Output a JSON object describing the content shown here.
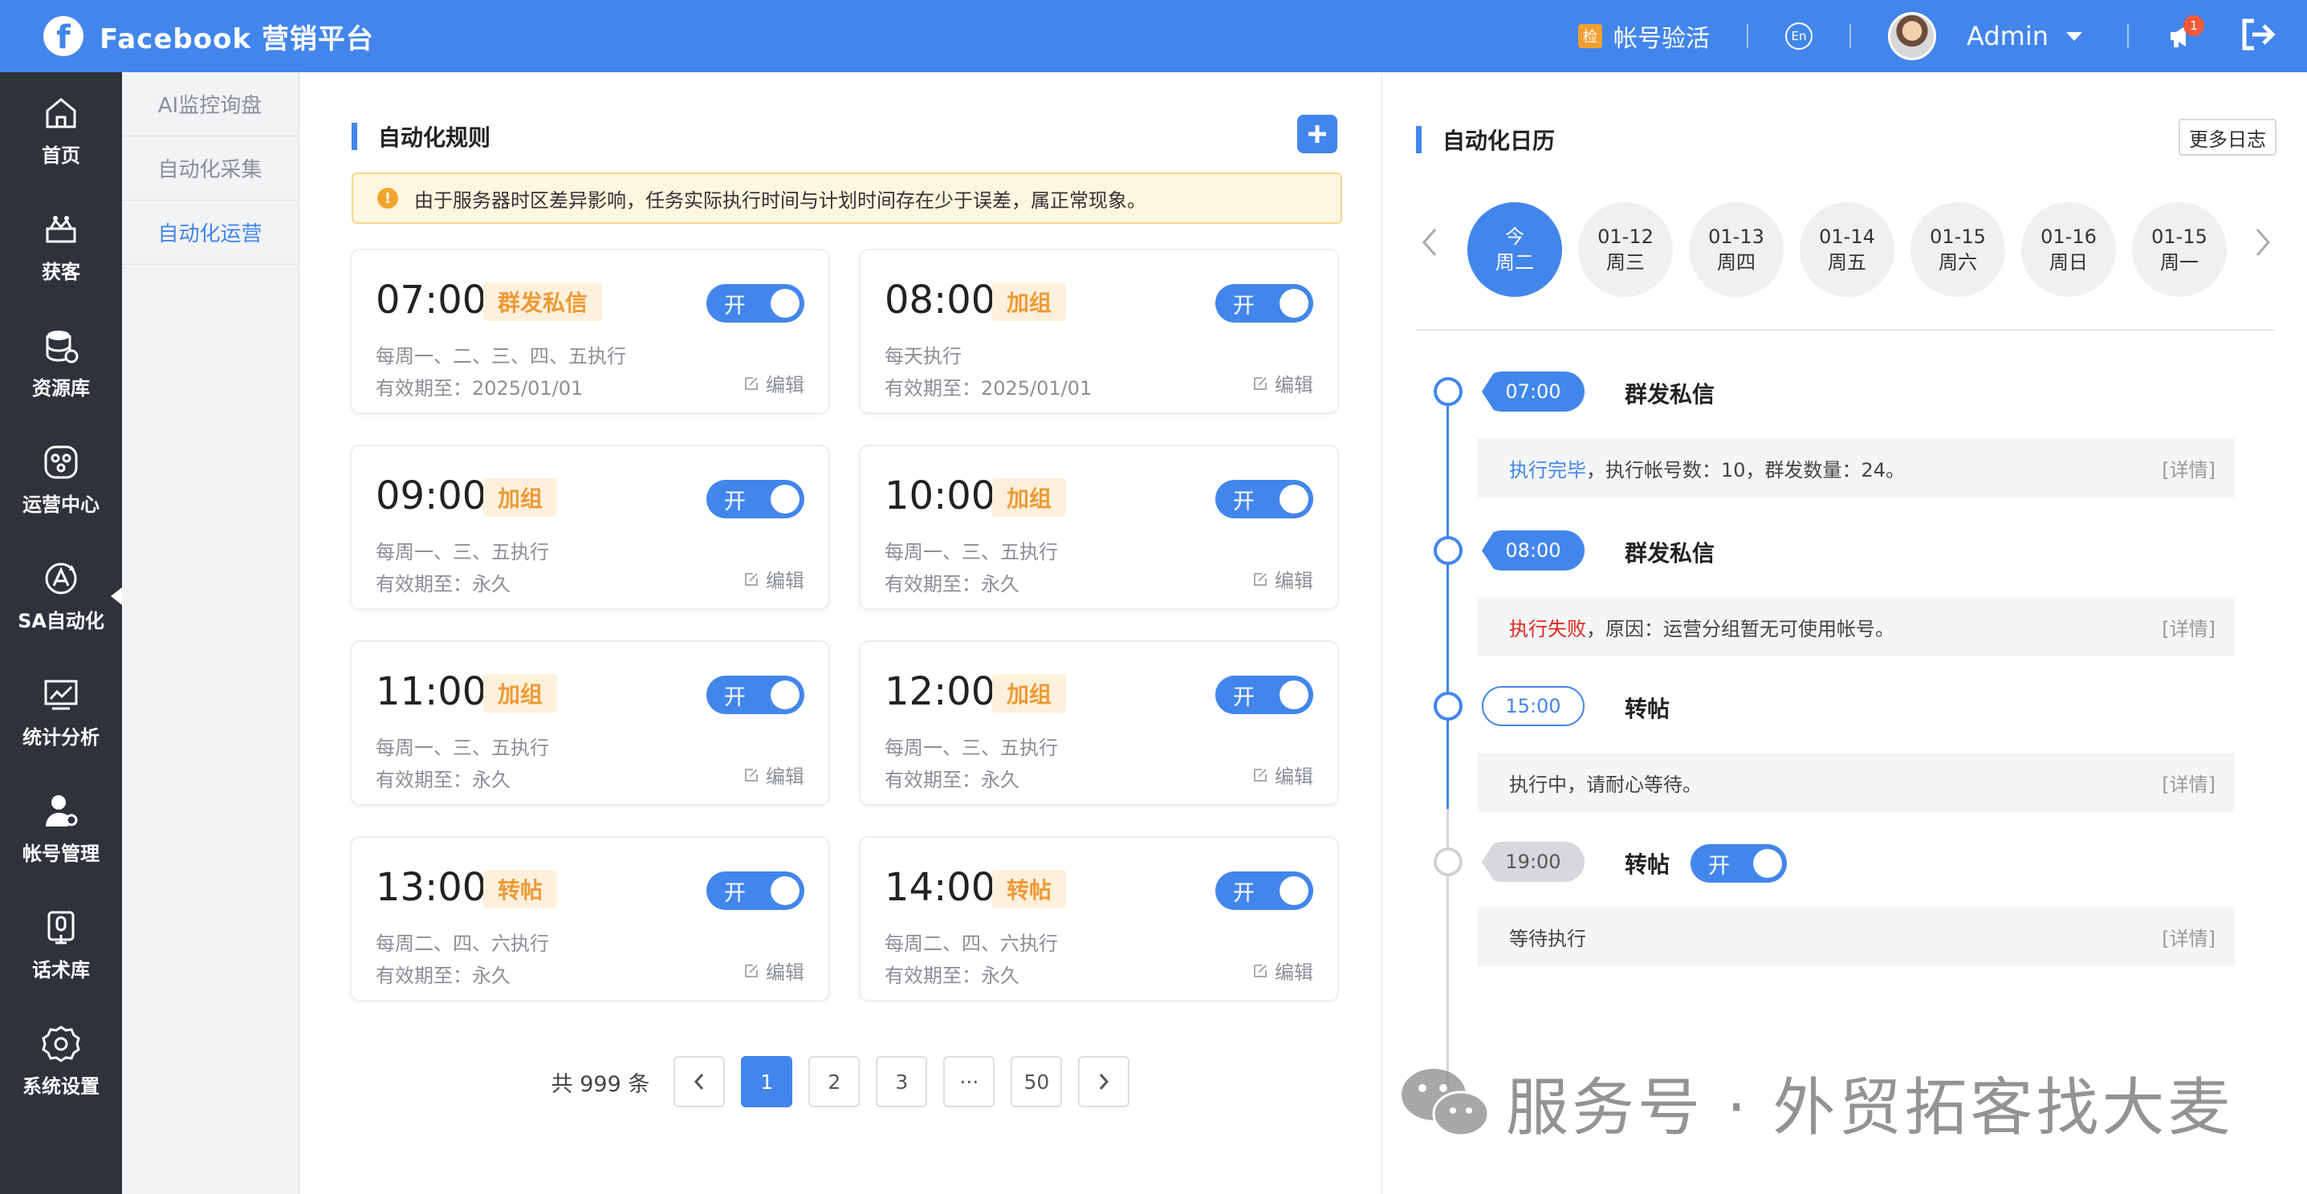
{
  "header": {
    "brand": "Facebook 营销平台",
    "verify_icon": "检",
    "verify_label": "帐号验活",
    "lang_label": "En",
    "user": "Admin",
    "badge_count": "1"
  },
  "sidebar": {
    "items": [
      {
        "label": "首页",
        "icon": "home-icon"
      },
      {
        "label": "获客",
        "icon": "acquire-icon"
      },
      {
        "label": "资源库",
        "icon": "database-icon"
      },
      {
        "label": "运营中心",
        "icon": "operation-icon"
      },
      {
        "label": "SA自动化",
        "icon": "automation-icon",
        "active": true
      },
      {
        "label": "统计分析",
        "icon": "chart-icon"
      },
      {
        "label": "帐号管理",
        "icon": "account-icon"
      },
      {
        "label": "话术库",
        "icon": "script-icon"
      },
      {
        "label": "系统设置",
        "icon": "gear-icon"
      }
    ]
  },
  "subnav": {
    "items": [
      {
        "label": "AI监控询盘"
      },
      {
        "label": "自动化采集"
      },
      {
        "label": "自动化运营",
        "active": true
      }
    ]
  },
  "rules": {
    "title": "自动化规则",
    "notice": "由于服务器时区差异影响，任务实际执行时间与计划时间存在少于误差，属正常现象。",
    "toggle_label": "开",
    "edit_label": "编辑",
    "cards": [
      {
        "time": "07:00",
        "tag": "群发私信",
        "freq": "每周一、二、三、四、五执行",
        "valid": "有效期至：2025/01/01"
      },
      {
        "time": "08:00",
        "tag": "加组",
        "freq": "每天执行",
        "valid": "有效期至：2025/01/01"
      },
      {
        "time": "09:00",
        "tag": "加组",
        "freq": "每周一、三、五执行",
        "valid": "有效期至：永久"
      },
      {
        "time": "10:00",
        "tag": "加组",
        "freq": "每周一、三、五执行",
        "valid": "有效期至：永久"
      },
      {
        "time": "11:00",
        "tag": "加组",
        "freq": "每周一、三、五执行",
        "valid": "有效期至：永久"
      },
      {
        "time": "12:00",
        "tag": "加组",
        "freq": "每周一、三、五执行",
        "valid": "有效期至：永久"
      },
      {
        "time": "13:00",
        "tag": "转帖",
        "freq": "每周二、四、六执行",
        "valid": "有效期至：永久"
      },
      {
        "time": "14:00",
        "tag": "转帖",
        "freq": "每周二、四、六执行",
        "valid": "有效期至：永久"
      }
    ],
    "pagination": {
      "total": "共 999 条",
      "pages": [
        "1",
        "2",
        "3",
        "···",
        "50"
      ],
      "current": "1"
    }
  },
  "calendar": {
    "title": "自动化日历",
    "more_logs": "更多日志",
    "days": [
      {
        "date": "今",
        "week": "周二",
        "today": true
      },
      {
        "date": "01-12",
        "week": "周三"
      },
      {
        "date": "01-13",
        "week": "周四"
      },
      {
        "date": "01-14",
        "week": "周五"
      },
      {
        "date": "01-15",
        "week": "周六"
      },
      {
        "date": "01-16",
        "week": "周日"
      },
      {
        "date": "01-15",
        "week": "周一"
      }
    ],
    "timeline": [
      {
        "time": "07:00",
        "name": "群发私信",
        "status": "执行完毕",
        "message": "，执行帐号数：10，群发数量：24。",
        "detail": "[详情]"
      },
      {
        "time": "08:00",
        "name": "群发私信",
        "status": "执行失败",
        "message": "，原因：运营分组暂无可使用帐号。",
        "detail": "[详情]"
      },
      {
        "time": "15:00",
        "name": "转帖",
        "status": "",
        "message": "执行中，请耐心等待。",
        "detail": "[详情]"
      },
      {
        "time": "19:00",
        "name": "转帖",
        "status": "",
        "message": "等待执行",
        "detail": "[详情]",
        "toggle": "开"
      }
    ]
  },
  "watermark": "服务号 · 外贸拓客找大麦"
}
